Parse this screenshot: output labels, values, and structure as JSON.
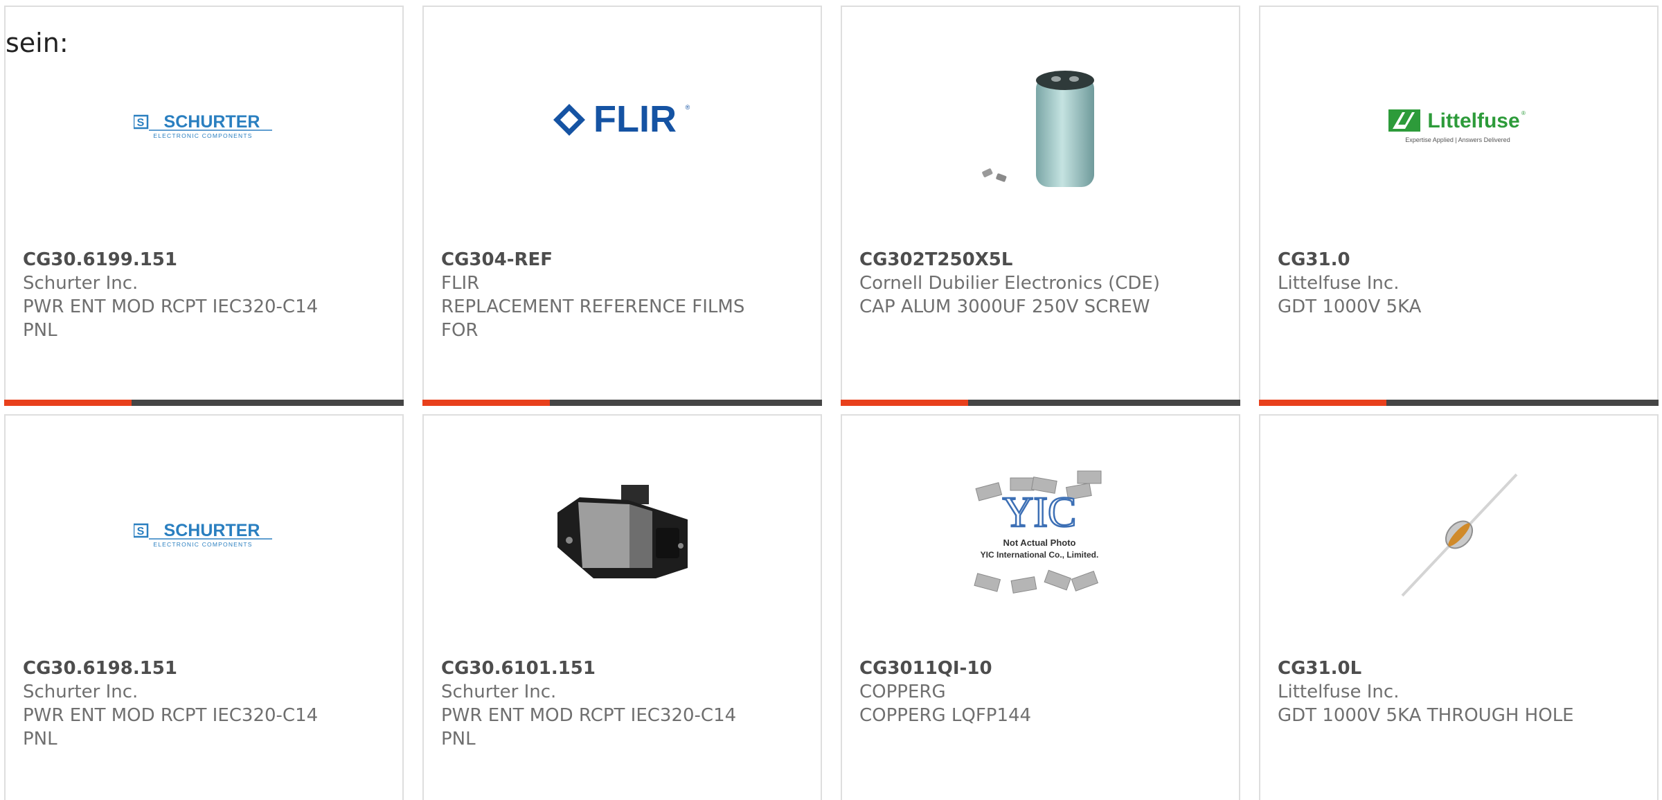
{
  "intro_text": "sein:",
  "accent_color": "#e8401c",
  "bar_color": "#454545",
  "products": [
    {
      "part_number": "CG30.6199.151",
      "manufacturer": "Schurter Inc.",
      "description": "PWR ENT MOD RCPT IEC320-C14 PNL",
      "image": "schurter-logo"
    },
    {
      "part_number": "CG304-REF",
      "manufacturer": "FLIR",
      "description": "REPLACEMENT REFERENCE FILMS FOR",
      "image": "flir-logo"
    },
    {
      "part_number": "CG302T250X5L",
      "manufacturer": "Cornell Dubilier Electronics (CDE)",
      "description": "CAP ALUM 3000UF 250V SCREW",
      "image": "capacitor-photo"
    },
    {
      "part_number": "CG31.0",
      "manufacturer": "Littelfuse Inc.",
      "description": "GDT 1000V 5KA",
      "image": "littelfuse-logo"
    },
    {
      "part_number": "CG30.6198.151",
      "manufacturer": "Schurter Inc.",
      "description": "PWR ENT MOD RCPT IEC320-C14 PNL",
      "image": "schurter-logo"
    },
    {
      "part_number": "CG30.6101.151",
      "manufacturer": "Schurter Inc.",
      "description": "PWR ENT MOD RCPT IEC320-C14 PNL",
      "image": "power-entry-module-photo"
    },
    {
      "part_number": "CG3011QI-10",
      "manufacturer": "COPPERG",
      "description": "COPPERG LQFP144",
      "image": "yic-placeholder-photo"
    },
    {
      "part_number": "CG31.0L",
      "manufacturer": "Littelfuse Inc.",
      "description": "GDT 1000V 5KA THROUGH HOLE",
      "image": "gdt-component-photo"
    }
  ],
  "logos": {
    "schurter": {
      "name": "SCHURTER",
      "tagline": "ELECTRONIC COMPONENTS",
      "mark": "S",
      "color": "#2a7fc0"
    },
    "flir": {
      "name": "FLIR",
      "trademark": "®",
      "color": "#1553a3"
    },
    "littelfuse": {
      "name": "Littelfuse",
      "trademark": "®",
      "tagline": "Expertise Applied | Answers Delivered",
      "color": "#2d9b3a"
    }
  },
  "placeholder_photo": {
    "line1": "Not Actual Photo",
    "line2": "YIC International Co., Limited.",
    "logo": "YIC"
  }
}
